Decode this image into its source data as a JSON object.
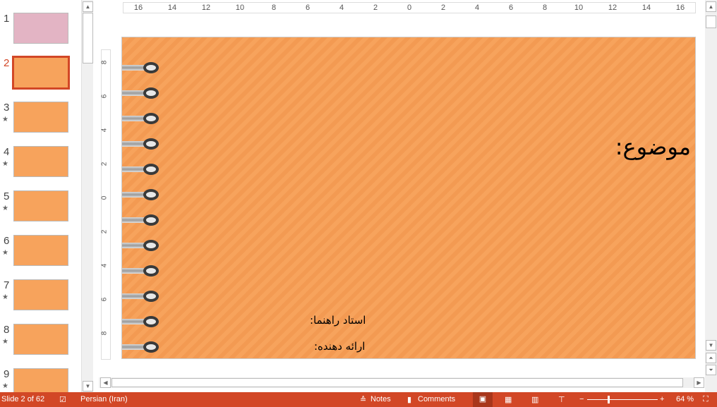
{
  "thumbnails": [
    {
      "num": "1",
      "star": false,
      "color": "#e3b4c4"
    },
    {
      "num": "2",
      "star": false,
      "color": "#f7a35c",
      "selected": true
    },
    {
      "num": "3",
      "star": true,
      "color": "#f7a35c"
    },
    {
      "num": "4",
      "star": true,
      "color": "#f7a35c"
    },
    {
      "num": "5",
      "star": true,
      "color": "#f7a35c"
    },
    {
      "num": "6",
      "star": true,
      "color": "#f7a35c"
    },
    {
      "num": "7",
      "star": true,
      "color": "#f7a35c"
    },
    {
      "num": "8",
      "star": true,
      "color": "#f7a35c"
    },
    {
      "num": "9",
      "star": true,
      "color": "#f7a35c"
    }
  ],
  "ruler": {
    "horizontal": [
      "16",
      "14",
      "12",
      "10",
      "8",
      "6",
      "4",
      "2",
      "0",
      "2",
      "4",
      "6",
      "8",
      "10",
      "12",
      "14",
      "16"
    ],
    "vertical": [
      "8",
      "6",
      "4",
      "2",
      "0",
      "2",
      "4",
      "6",
      "8"
    ]
  },
  "slide": {
    "title": "موضوع:",
    "supervisor": "استاد راهنما:",
    "presenter": "ارائه دهنده:",
    "background": "#f7a35c",
    "ring_count": 12
  },
  "status": {
    "slide_info": "Slide 2 of 62",
    "language": "Persian (Iran)",
    "notes": "Notes",
    "comments": "Comments",
    "zoom": "64 %",
    "accent": "#d24726"
  }
}
